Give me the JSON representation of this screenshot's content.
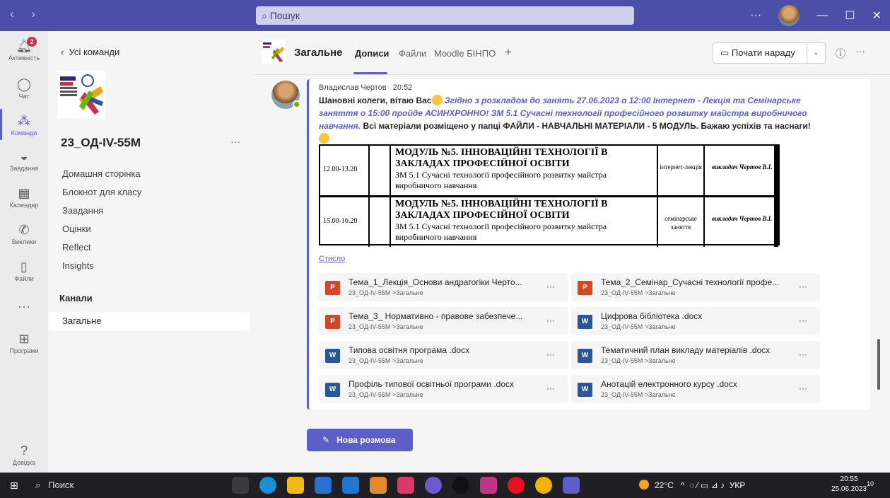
{
  "titlebar": {
    "search_placeholder": "Пошук",
    "more": "···",
    "minimize": "—",
    "maximize": "☐",
    "close": "✕"
  },
  "rail": [
    {
      "label": "Активність",
      "icon": "bell-icon",
      "badge": "2"
    },
    {
      "label": "Чат",
      "icon": "chat-icon"
    },
    {
      "label": "Команди",
      "icon": "teams-icon",
      "active": true
    },
    {
      "label": "Завдання",
      "icon": "assignments-icon"
    },
    {
      "label": "Календар",
      "icon": "calendar-icon"
    },
    {
      "label": "Виклики",
      "icon": "phone-icon"
    },
    {
      "label": "Файли",
      "icon": "file-icon"
    },
    {
      "label": "···",
      "icon": "more-icon"
    },
    {
      "label": "Програми",
      "icon": "apps-icon"
    },
    {
      "label": "Довідка",
      "icon": "help-icon"
    }
  ],
  "team_panel": {
    "back": "Усі команди",
    "team_name": "23_ОД-IV-55М",
    "more": "···",
    "links": [
      "Домашня сторінка",
      "Блокнот для класу",
      "Завдання",
      "Оцінки",
      "Reflect",
      "Insights"
    ],
    "channels_header": "Канали",
    "channel": "Загальне"
  },
  "channel_header": {
    "title": "Загальне",
    "tabs": [
      "Дописи",
      "Файли",
      "Moodle БІНПО"
    ],
    "add_tab": "+",
    "meet_button": "Почати нараду",
    "meet_dropdown": "⌄",
    "info": "ⓘ",
    "more": "···"
  },
  "message": {
    "author": "Владислав Чертов",
    "time": "20:52",
    "text_a": "Шановні колеги, вітаю Вас",
    "text_b": "Згідно з розкладом до занять 27.06.2023 о 12:00 Інтернет - Лекція та Семінарське заняття о 15:00 пройде АСИНХРОННО! ЗМ 5.1 Сучасні технології професійного розвитку майстра виробничого навчання.",
    "text_c": "Всі матеріали розміщено у папці ФАЙЛИ - НАВЧАЛЬНІ МАТЕРІАЛИ - 5 МОДУЛЬ. Бажаю успіхів та наснаги!",
    "schedule": [
      {
        "time": "12.00-13.20",
        "module": "МОДУЛЬ №5. ІННОВАЦІЙНІ ТЕХНОЛОГІЇ В ЗАКЛАДАХ ПРОФЕСІЙНОЇ ОСВІТИ",
        "topic": "ЗМ 5.1 Сучасні технології професійного розвитку майстра виробничого навчання",
        "kind": "інтернет-лекція",
        "teacher": "викладач Чертов В.І."
      },
      {
        "time": "15.00-16.20",
        "module": "МОДУЛЬ №5. ІННОВАЦІЙНІ ТЕХНОЛОГІЇ В ЗАКЛАДАХ ПРОФЕСІЙНОЇ ОСВІТИ",
        "topic": "ЗМ 5.1 Сучасні технології професійного розвитку майстра виробничого навчання",
        "kind": "семінарське заняття",
        "teacher": "викладач Чертов В.І."
      }
    ],
    "collapse": "Стисло",
    "files": [
      {
        "name": "Тема_1_Лекція_Основи андрагогіки Черто...",
        "type": "ppt",
        "path": "23_ОД-IV-55М >Загальне"
      },
      {
        "name": "Тема_2_Семінар_Сучасні технології профе...",
        "type": "ppt",
        "path": "23_ОД-IV-55М >Загальне"
      },
      {
        "name": "Тема_3_ Нормативно - правове забезпече...",
        "type": "ppt",
        "path": "23_ОД-IV-55М >Загальне"
      },
      {
        "name": "Цифрова бібліотека .docx",
        "type": "doc",
        "path": "23_ОД-IV-55М >Загальне"
      },
      {
        "name": "Типова освітня програма .docx",
        "type": "doc",
        "path": "23_ОД-IV-55М >Загальне"
      },
      {
        "name": "Тематичний план викладу матеріалів .docx",
        "type": "doc",
        "path": "23_ОД-IV-55М >Загальне"
      },
      {
        "name": "Профіль типової освітньої програми .docx",
        "type": "doc",
        "path": "23_ОД-IV-55М >Загальне"
      },
      {
        "name": "Анотацій електронного курсу .docx",
        "type": "doc",
        "path": "23_ОД-IV-55М >Загальне"
      }
    ],
    "file_more": "···"
  },
  "new_conversation": "Нова розмова",
  "taskbar": {
    "search": "Поиск",
    "temperature": "22°C",
    "language": "УКР",
    "time": "20:55",
    "date": "25.06.2023",
    "notifications": "10"
  },
  "colors": {
    "accent": "#5b5fc7",
    "titlebar": "#4b4fa8",
    "ppt": "#d24726",
    "word": "#2b579a"
  }
}
